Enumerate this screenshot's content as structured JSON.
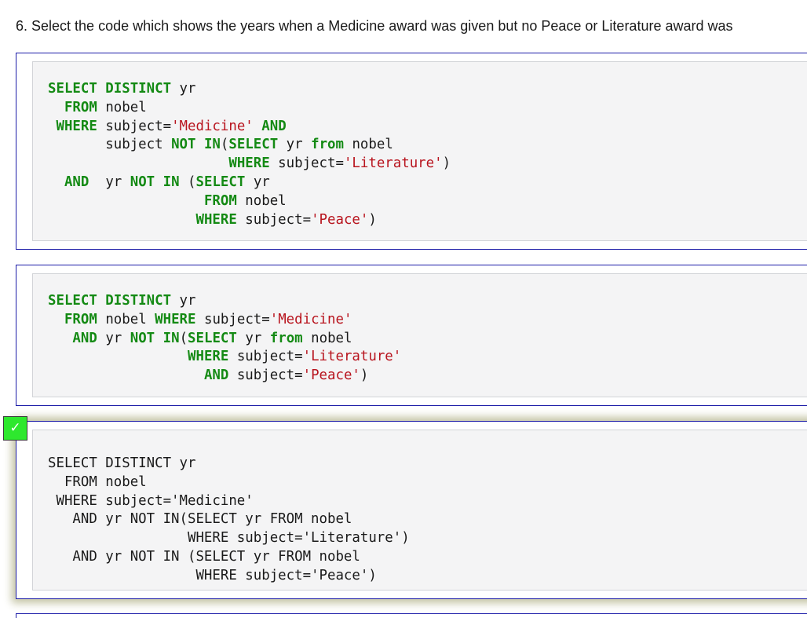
{
  "question": {
    "text": "6. Select the code which shows the years when a Medicine award was given but no Peace or Literature award was"
  },
  "options": [
    {
      "lines": [
        [
          {
            "t": "SELECT DISTINCT",
            "c": "kw"
          },
          {
            "t": " yr"
          }
        ],
        [
          {
            "t": "  "
          },
          {
            "t": "FROM",
            "c": "kw"
          },
          {
            "t": " nobel"
          }
        ],
        [
          {
            "t": " "
          },
          {
            "t": "WHERE",
            "c": "kw"
          },
          {
            "t": " subject="
          },
          {
            "t": "'Medicine'",
            "c": "str"
          },
          {
            "t": " "
          },
          {
            "t": "AND",
            "c": "kw"
          }
        ],
        [
          {
            "t": "       subject "
          },
          {
            "t": "NOT IN",
            "c": "kw"
          },
          {
            "t": "("
          },
          {
            "t": "SELECT",
            "c": "kw"
          },
          {
            "t": " yr "
          },
          {
            "t": "from",
            "c": "kw"
          },
          {
            "t": " nobel"
          }
        ],
        [
          {
            "t": "                      "
          },
          {
            "t": "WHERE",
            "c": "kw"
          },
          {
            "t": " subject="
          },
          {
            "t": "'Literature'",
            "c": "str"
          },
          {
            "t": ")"
          }
        ],
        [
          {
            "t": "  "
          },
          {
            "t": "AND",
            "c": "kw"
          },
          {
            "t": "  yr "
          },
          {
            "t": "NOT IN",
            "c": "kw"
          },
          {
            "t": " ("
          },
          {
            "t": "SELECT",
            "c": "kw"
          },
          {
            "t": " yr"
          }
        ],
        [
          {
            "t": "                   "
          },
          {
            "t": "FROM",
            "c": "kw"
          },
          {
            "t": " nobel"
          }
        ],
        [
          {
            "t": "                  "
          },
          {
            "t": "WHERE",
            "c": "kw"
          },
          {
            "t": " subject="
          },
          {
            "t": "'Peace'",
            "c": "str"
          },
          {
            "t": ")"
          }
        ]
      ]
    },
    {
      "lines": [
        [
          {
            "t": "SELECT DISTINCT",
            "c": "kw"
          },
          {
            "t": " yr"
          }
        ],
        [
          {
            "t": "  "
          },
          {
            "t": "FROM",
            "c": "kw"
          },
          {
            "t": " nobel "
          },
          {
            "t": "WHERE",
            "c": "kw"
          },
          {
            "t": " subject="
          },
          {
            "t": "'Medicine'",
            "c": "str"
          }
        ],
        [
          {
            "t": "   "
          },
          {
            "t": "AND",
            "c": "kw"
          },
          {
            "t": " yr "
          },
          {
            "t": "NOT IN",
            "c": "kw"
          },
          {
            "t": "("
          },
          {
            "t": "SELECT",
            "c": "kw"
          },
          {
            "t": " yr "
          },
          {
            "t": "from",
            "c": "kw"
          },
          {
            "t": " nobel"
          }
        ],
        [
          {
            "t": "                 "
          },
          {
            "t": "WHERE",
            "c": "kw"
          },
          {
            "t": " subject="
          },
          {
            "t": "'Literature'",
            "c": "str"
          }
        ],
        [
          {
            "t": "                   "
          },
          {
            "t": "AND",
            "c": "kw"
          },
          {
            "t": " subject="
          },
          {
            "t": "'Peace'",
            "c": "str"
          },
          {
            "t": ")"
          }
        ]
      ]
    },
    {
      "lines": [
        [
          {
            "t": "SELECT DISTINCT yr"
          }
        ],
        [
          {
            "t": "  FROM nobel"
          }
        ],
        [
          {
            "t": " WHERE subject='Medicine'"
          }
        ],
        [
          {
            "t": "   AND yr NOT IN(SELECT yr FROM nobel"
          }
        ],
        [
          {
            "t": "                 WHERE subject='Literature')"
          }
        ],
        [
          {
            "t": "   AND yr NOT IN (SELECT yr FROM nobel"
          }
        ],
        [
          {
            "t": "                  WHERE subject='Peace')"
          }
        ]
      ]
    }
  ],
  "selected_marker": {
    "text": "✓",
    "color": "#2ee82e"
  }
}
